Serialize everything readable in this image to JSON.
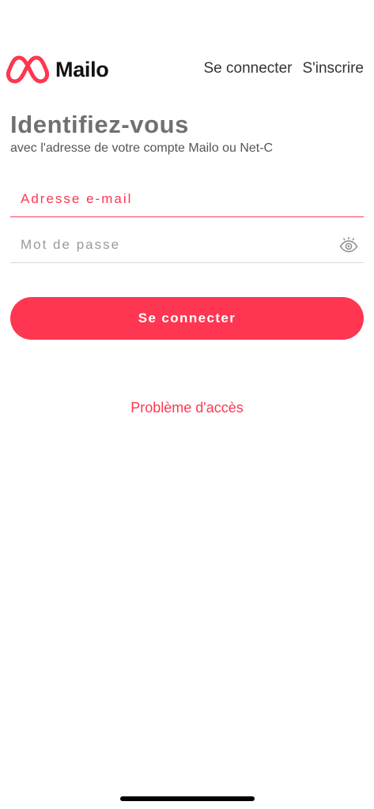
{
  "header": {
    "brand": "Mailo",
    "nav": {
      "login_label": "Se connecter",
      "signup_label": "S'inscrire"
    }
  },
  "main": {
    "title": "Identifiez-vous",
    "subtitle": "avec l'adresse de votre compte Mailo ou Net-C",
    "email_field": {
      "placeholder": "Adresse e-mail",
      "value": ""
    },
    "password_field": {
      "placeholder": "Mot de passe",
      "value": ""
    },
    "submit_label": "Se connecter",
    "access_problem_label": "Problème d'accès"
  },
  "colors": {
    "accent": "#ff3651",
    "title": "#707070",
    "text": "#333333"
  },
  "icons": {
    "logo": "mailo-logo-icon",
    "password_toggle": "eye-icon"
  }
}
